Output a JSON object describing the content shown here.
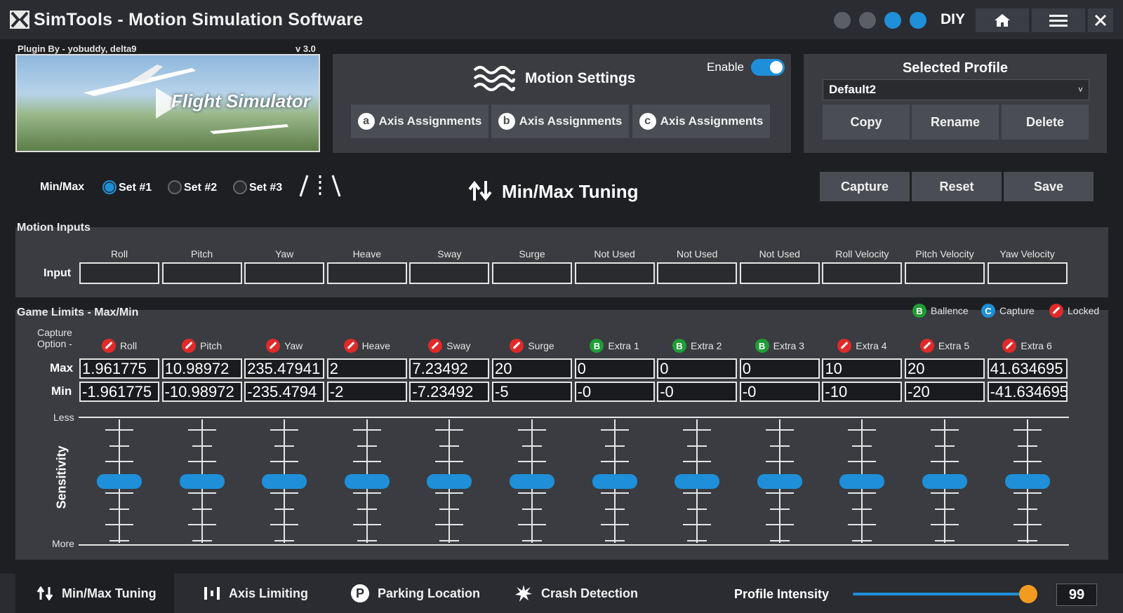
{
  "app": {
    "title": "SimTools - Motion Simulation Software",
    "diy_label": "DIY"
  },
  "plugin": {
    "author": "Plugin By - yobuddy, delta9",
    "version": "v 3.0",
    "game_image_text": "Flight Simulator"
  },
  "motion_settings": {
    "title": "Motion Settings",
    "enable_label": "Enable",
    "enabled": true,
    "axis_buttons": [
      {
        "badge": "a",
        "label": "Axis Assignments"
      },
      {
        "badge": "b",
        "label": "Axis Assignments"
      },
      {
        "badge": "c",
        "label": "Axis Assignments"
      }
    ]
  },
  "profile": {
    "title": "Selected Profile",
    "selected": "Default2",
    "copy_label": "Copy",
    "rename_label": "Rename",
    "delete_label": "Delete"
  },
  "minmax": {
    "label": "Min/Max",
    "sets": [
      "Set #1",
      "Set #2",
      "Set #3"
    ],
    "selected_set": 0,
    "title": "Min/Max Tuning",
    "capture_label": "Capture",
    "reset_label": "Reset",
    "save_label": "Save"
  },
  "motion_inputs": {
    "title": "Motion Inputs",
    "row_label": "Input",
    "columns": [
      "Roll",
      "Pitch",
      "Yaw",
      "Heave",
      "Sway",
      "Surge",
      "Not Used",
      "Not Used",
      "Not Used",
      "Roll Velocity",
      "Pitch Velocity",
      "Yaw Velocity"
    ]
  },
  "game_limits": {
    "title": "Game Limits - Max/Min",
    "capture_option_label_1": "Capture",
    "capture_option_label_2": "Option -",
    "legend": [
      {
        "icon": "green",
        "label": "Ballence"
      },
      {
        "icon": "blue",
        "label": "Capture"
      },
      {
        "icon": "red",
        "label": "Locked"
      }
    ],
    "max_label": "Max",
    "min_label": "Min",
    "columns": [
      {
        "name": "Roll",
        "icon": "red",
        "max": "1.961775",
        "min": "-1.961775"
      },
      {
        "name": "Pitch",
        "icon": "red",
        "max": "10.98972",
        "min": "-10.98972"
      },
      {
        "name": "Yaw",
        "icon": "red",
        "max": "235.47941",
        "min": "-235.4794"
      },
      {
        "name": "Heave",
        "icon": "red",
        "max": "2",
        "min": "-2"
      },
      {
        "name": "Sway",
        "icon": "red",
        "max": "7.23492",
        "min": "-7.23492"
      },
      {
        "name": "Surge",
        "icon": "red",
        "max": "20",
        "min": "-5"
      },
      {
        "name": "Extra 1",
        "icon": "green",
        "max": "0",
        "min": "-0"
      },
      {
        "name": "Extra 2",
        "icon": "green",
        "max": "0",
        "min": "-0"
      },
      {
        "name": "Extra 3",
        "icon": "green",
        "max": "0",
        "min": "-0"
      },
      {
        "name": "Extra 4",
        "icon": "red",
        "max": "10",
        "min": "-10"
      },
      {
        "name": "Extra 5",
        "icon": "red",
        "max": "20",
        "min": "-20"
      },
      {
        "name": "Extra 6",
        "icon": "red",
        "max": "41.634695",
        "min": "-41.634695"
      }
    ],
    "sensitivity_label": "Sensitivity",
    "less_label": "Less",
    "more_label": "More",
    "sensitivity_level": 0.5
  },
  "bottom": {
    "tabs": [
      "Min/Max Tuning",
      "Axis Limiting",
      "Parking Location",
      "Crash Detection"
    ],
    "active_tab": 0,
    "intensity_label": "Profile Intensity",
    "intensity_value": "99",
    "intensity_level": 0.99
  },
  "colors": {
    "accent": "#1e8fd8",
    "locked": "#e02a2a",
    "balance": "#1f9e35",
    "slider_knob": "#f39a21"
  }
}
